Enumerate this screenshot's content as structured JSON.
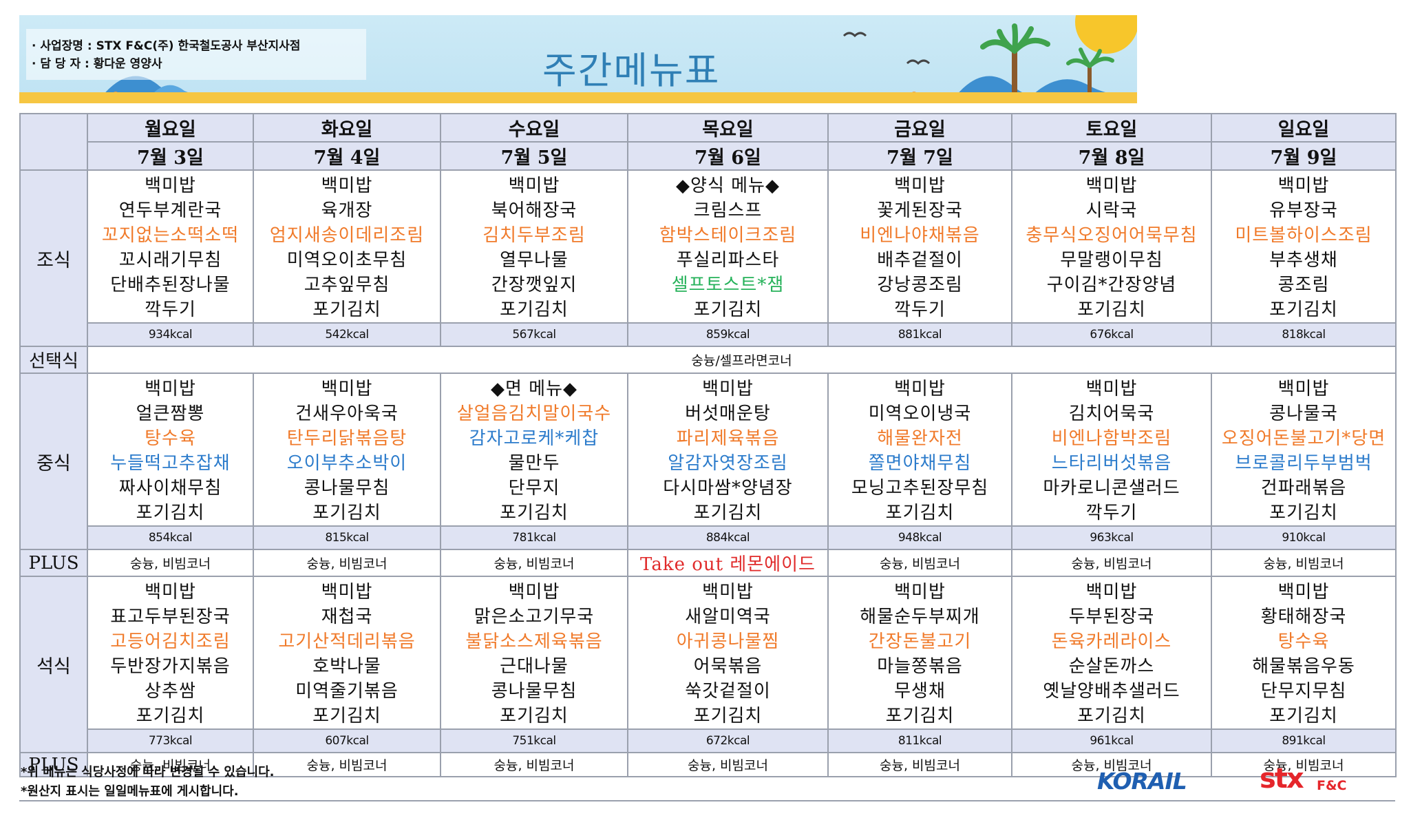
{
  "header": {
    "info_line1": "· 사업장명 : STX F&C(주) 한국철도공사 부산지사점",
    "info_line2": "· 담 당 자  : 황다운 영양사",
    "title": "주간메뉴표"
  },
  "days": [
    {
      "name": "월요일",
      "date": "7월 3일"
    },
    {
      "name": "화요일",
      "date": "7월 4일"
    },
    {
      "name": "수요일",
      "date": "7월 5일"
    },
    {
      "name": "목요일",
      "date": "7월 6일"
    },
    {
      "name": "금요일",
      "date": "7월 7일"
    },
    {
      "name": "토요일",
      "date": "7월 8일"
    },
    {
      "name": "일요일",
      "date": "7월 9일"
    }
  ],
  "labels": {
    "breakfast": "조식",
    "select": "선택식",
    "lunch": "중식",
    "plus": "PLUS",
    "dinner": "석식"
  },
  "select_text": "숭늉/셀프라면코너",
  "breakfast": {
    "menus": [
      [
        {
          "t": "백미밥"
        },
        {
          "t": "연두부계란국"
        },
        {
          "t": "꼬지없는소떡소떡",
          "c": "orange"
        },
        {
          "t": "꼬시래기무침"
        },
        {
          "t": "단배추된장나물"
        },
        {
          "t": "깍두기"
        }
      ],
      [
        {
          "t": "백미밥"
        },
        {
          "t": "육개장"
        },
        {
          "t": "엄지새송이데리조림",
          "c": "orange"
        },
        {
          "t": "미역오이초무침"
        },
        {
          "t": "고추잎무침"
        },
        {
          "t": "포기김치"
        }
      ],
      [
        {
          "t": "백미밥"
        },
        {
          "t": "북어해장국"
        },
        {
          "t": "김치두부조림",
          "c": "orange"
        },
        {
          "t": "열무나물"
        },
        {
          "t": "간장깻잎지"
        },
        {
          "t": "포기김치"
        }
      ],
      [
        {
          "t": "◆양식 메뉴◆"
        },
        {
          "t": "크림스프"
        },
        {
          "t": "함박스테이크조림",
          "c": "orange"
        },
        {
          "t": "푸실리파스타"
        },
        {
          "t": "셀프토스트*잼",
          "c": "green"
        },
        {
          "t": "포기김치"
        }
      ],
      [
        {
          "t": "백미밥"
        },
        {
          "t": "꽃게된장국"
        },
        {
          "t": "비엔나야채볶음",
          "c": "orange"
        },
        {
          "t": "배추겉절이"
        },
        {
          "t": "강낭콩조림"
        },
        {
          "t": "깍두기"
        }
      ],
      [
        {
          "t": "백미밥"
        },
        {
          "t": "시락국"
        },
        {
          "t": "충무식오징어어묵무침",
          "c": "orange"
        },
        {
          "t": "무말랭이무침"
        },
        {
          "t": "구이김*간장양념"
        },
        {
          "t": "포기김치"
        }
      ],
      [
        {
          "t": "백미밥"
        },
        {
          "t": "유부장국"
        },
        {
          "t": "미트볼하이스조림",
          "c": "orange"
        },
        {
          "t": "부추생채"
        },
        {
          "t": "콩조림"
        },
        {
          "t": "포기김치"
        }
      ]
    ],
    "kcal": [
      "934kcal",
      "542kcal",
      "567kcal",
      "859kcal",
      "881kcal",
      "676kcal",
      "818kcal"
    ]
  },
  "lunch": {
    "menus": [
      [
        {
          "t": "백미밥"
        },
        {
          "t": "얼큰짬뽕"
        },
        {
          "t": "탕수육",
          "c": "orange"
        },
        {
          "t": "누들떡고추잡채",
          "c": "blue"
        },
        {
          "t": "짜사이채무침"
        },
        {
          "t": "포기김치"
        }
      ],
      [
        {
          "t": "백미밥"
        },
        {
          "t": "건새우아욱국"
        },
        {
          "t": "탄두리닭볶음탕",
          "c": "orange"
        },
        {
          "t": "오이부추소박이",
          "c": "blue"
        },
        {
          "t": "콩나물무침"
        },
        {
          "t": "포기김치"
        }
      ],
      [
        {
          "t": "◆면 메뉴◆"
        },
        {
          "t": "살얼음김치말이국수",
          "c": "orange"
        },
        {
          "t": "감자고로케*케찹",
          "c": "blue"
        },
        {
          "t": "물만두"
        },
        {
          "t": "단무지"
        },
        {
          "t": "포기김치"
        }
      ],
      [
        {
          "t": "백미밥"
        },
        {
          "t": "버섯매운탕"
        },
        {
          "t": "파리제육볶음",
          "c": "orange"
        },
        {
          "t": "알감자엿장조림",
          "c": "blue"
        },
        {
          "t": "다시마쌈*양념장"
        },
        {
          "t": "포기김치"
        }
      ],
      [
        {
          "t": "백미밥"
        },
        {
          "t": "미역오이냉국"
        },
        {
          "t": "해물완자전",
          "c": "orange"
        },
        {
          "t": "쫄면야채무침",
          "c": "blue"
        },
        {
          "t": "모닝고추된장무침"
        },
        {
          "t": "포기김치"
        }
      ],
      [
        {
          "t": "백미밥"
        },
        {
          "t": "김치어묵국"
        },
        {
          "t": "비엔나함박조림",
          "c": "orange"
        },
        {
          "t": "느타리버섯볶음",
          "c": "blue"
        },
        {
          "t": "마카로니콘샐러드"
        },
        {
          "t": "깍두기"
        }
      ],
      [
        {
          "t": "백미밥"
        },
        {
          "t": "콩나물국"
        },
        {
          "t": "오징어돈불고기*당면",
          "c": "orange"
        },
        {
          "t": "브로콜리두부범벅",
          "c": "blue"
        },
        {
          "t": "건파래볶음"
        },
        {
          "t": "포기김치"
        }
      ]
    ],
    "kcal": [
      "854kcal",
      "815kcal",
      "781kcal",
      "884kcal",
      "948kcal",
      "963kcal",
      "910kcal"
    ],
    "plus": [
      "숭늉, 비빔코너",
      "숭늉, 비빔코너",
      "숭늉, 비빔코너",
      "Take out 레몬에이드",
      "숭늉, 비빔코너",
      "숭늉, 비빔코너",
      "숭늉, 비빔코너"
    ]
  },
  "dinner": {
    "menus": [
      [
        {
          "t": "백미밥"
        },
        {
          "t": "표고두부된장국"
        },
        {
          "t": "고등어김치조림",
          "c": "orange"
        },
        {
          "t": "두반장가지볶음"
        },
        {
          "t": "상추쌈"
        },
        {
          "t": "포기김치"
        }
      ],
      [
        {
          "t": "백미밥"
        },
        {
          "t": "재첩국"
        },
        {
          "t": "고기산적데리볶음",
          "c": "orange"
        },
        {
          "t": "호박나물"
        },
        {
          "t": "미역줄기볶음"
        },
        {
          "t": "포기김치"
        }
      ],
      [
        {
          "t": "백미밥"
        },
        {
          "t": "맑은소고기무국"
        },
        {
          "t": "불닭소스제육볶음",
          "c": "orange"
        },
        {
          "t": "근대나물"
        },
        {
          "t": "콩나물무침"
        },
        {
          "t": "포기김치"
        }
      ],
      [
        {
          "t": "백미밥"
        },
        {
          "t": "새알미역국"
        },
        {
          "t": "아귀콩나물찜",
          "c": "orange"
        },
        {
          "t": "어묵볶음"
        },
        {
          "t": "쑥갓겉절이"
        },
        {
          "t": "포기김치"
        }
      ],
      [
        {
          "t": "백미밥"
        },
        {
          "t": "해물순두부찌개"
        },
        {
          "t": "간장돈불고기",
          "c": "orange"
        },
        {
          "t": "마늘쫑볶음"
        },
        {
          "t": "무생채"
        },
        {
          "t": "포기김치"
        }
      ],
      [
        {
          "t": "백미밥"
        },
        {
          "t": "두부된장국"
        },
        {
          "t": "돈육카레라이스",
          "c": "orange"
        },
        {
          "t": "순살돈까스"
        },
        {
          "t": "옛날양배추샐러드"
        },
        {
          "t": "포기김치"
        }
      ],
      [
        {
          "t": "백미밥"
        },
        {
          "t": "황태해장국"
        },
        {
          "t": "탕수육",
          "c": "orange"
        },
        {
          "t": "해물볶음우동"
        },
        {
          "t": "단무지무침"
        },
        {
          "t": "포기김치"
        }
      ]
    ],
    "kcal": [
      "773kcal",
      "607kcal",
      "751kcal",
      "672kcal",
      "811kcal",
      "961kcal",
      "891kcal"
    ],
    "plus": [
      "숭늉, 비빔코너",
      "숭늉, 비빔코너",
      "숭늉, 비빔코너",
      "숭늉, 비빔코너",
      "숭늉, 비빔코너",
      "숭늉, 비빔코너",
      "숭늉, 비빔코너"
    ]
  },
  "footer": {
    "note1": "*위 메뉴는 식당사정에 따라 변경될 수 있습니다.",
    "note2": "*원산지 표시는 일일메뉴표에 게시합니다.",
    "logo_korail": "KORAIL",
    "logo_stx": "stx",
    "logo_fc": "F&C"
  },
  "colors": {
    "highlight_orange": "#f07a2a",
    "highlight_blue": "#2b7bcb",
    "highlight_green": "#26b25a",
    "takeout_red": "#e02a2a",
    "header_fill": "#dfe3f3",
    "title_blue": "#2f7fb5"
  }
}
